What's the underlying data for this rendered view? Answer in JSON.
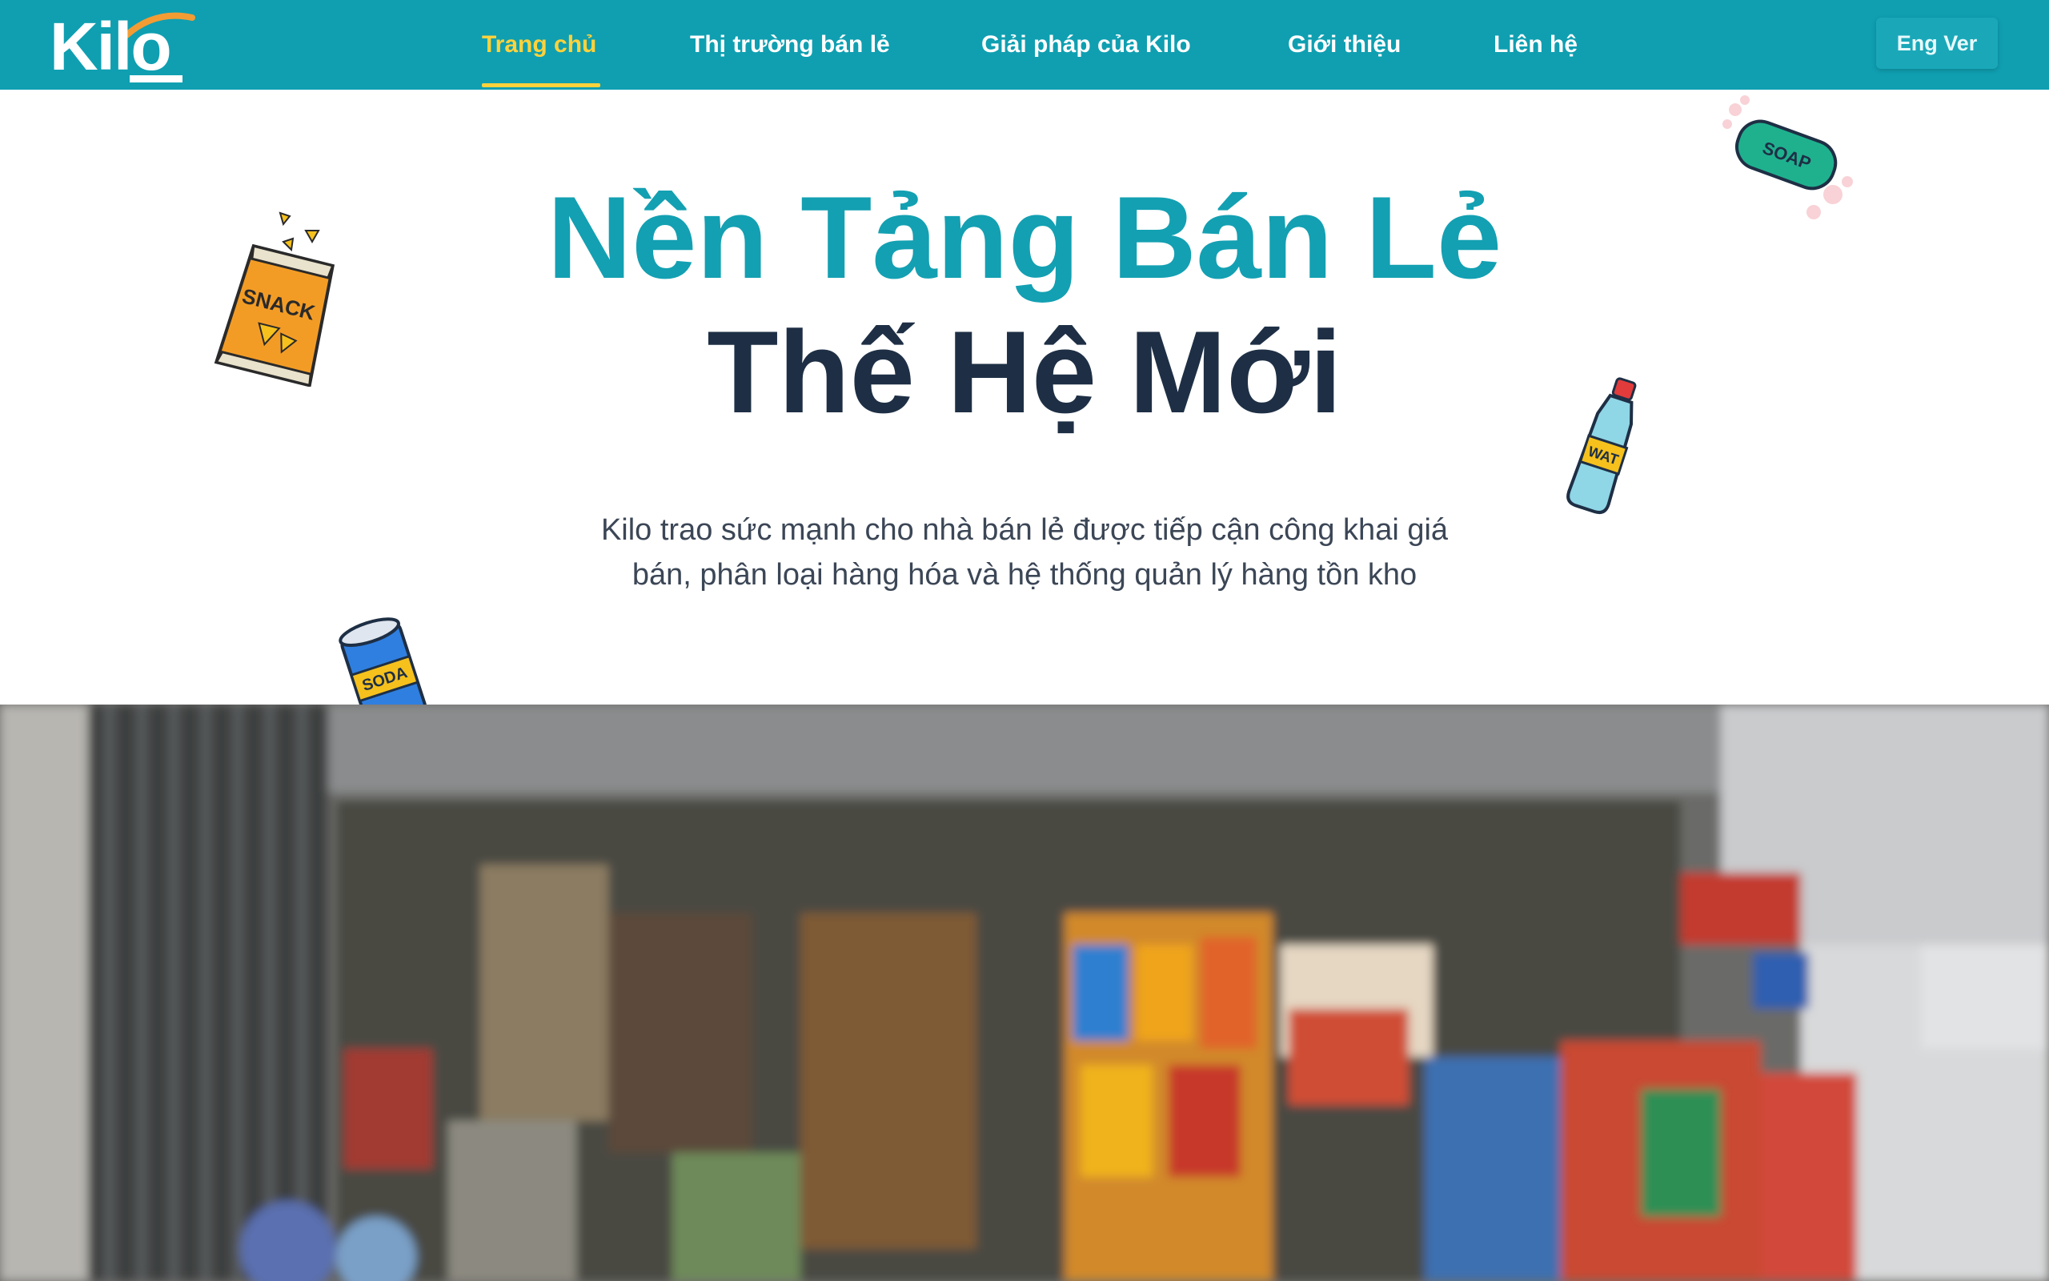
{
  "brand": {
    "logo_text": "Kilo",
    "color": "#0f9fb1",
    "accent": "#ffd23c"
  },
  "nav": {
    "items": [
      {
        "label": "Trang chủ",
        "active": true
      },
      {
        "label": "Thị trường bán lẻ",
        "active": false
      },
      {
        "label": "Giải pháp của Kilo",
        "active": false
      },
      {
        "label": "Giới thiệu",
        "active": false
      },
      {
        "label": "Liên hệ",
        "active": false
      }
    ],
    "lang_button": "Eng Ver"
  },
  "hero": {
    "title_line1": "Nền Tảng Bán Lẻ",
    "title_line2": "Thế Hệ Mới",
    "subtitle": "Kilo trao sức mạnh cho nhà bán lẻ được tiếp cận công khai giá bán, phân loại hàng hóa và hệ thống quản lý hàng tồn kho"
  },
  "stickers": {
    "snack_label": "SNACK",
    "soap_label": "SOAP",
    "water_label": "WAT",
    "soda_label": "SODA"
  }
}
